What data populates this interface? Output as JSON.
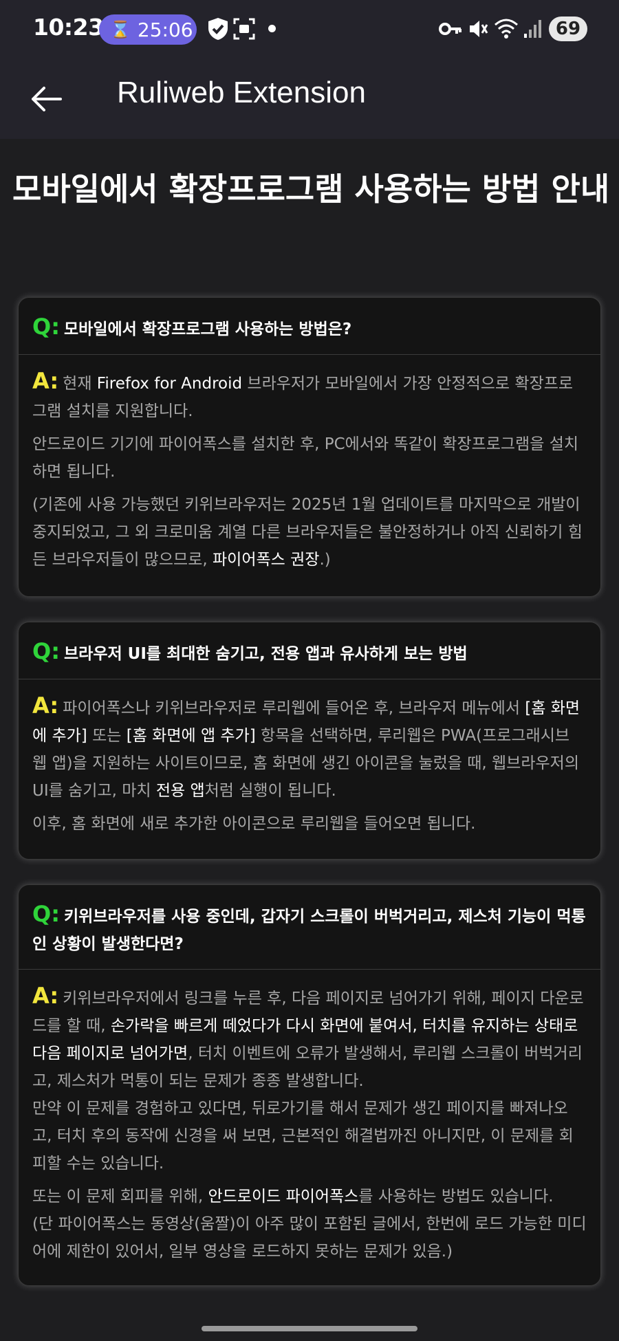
{
  "status_bar": {
    "time": "10:23",
    "timer": "25:06",
    "battery": "69"
  },
  "app_bar": {
    "title": "Ruliweb Extension"
  },
  "page": {
    "title": "모바일에서 확장프로그램 사용하는 방법 안내"
  },
  "faq": [
    {
      "q_mark": "Q:",
      "question": "모바일에서 확장프로그램 사용하는 방법은?",
      "a_mark": "A:",
      "p1_a": "현재 ",
      "p1_b": "Firefox for Android",
      "p1_c": " 브라우저가 모바일에서 가장 안정적으로 확장프로그램 설치를 지원합니다.",
      "p2": "안드로이드 기기에 파이어폭스를 설치한 후, PC에서와 똑같이 확장프로그램을 설치하면 됩니다.",
      "p3_a": "(기존에 사용 가능했던 키위브라우저는 2025년 1월 업데이트를 마지막으로 개발이 중지되었고, 그 외 크로미움 계열 다른 브라우저들은 불안정하거나 아직 신뢰하기 힘든 브라우저들이 많으므로, ",
      "p3_b": "파이어폭스 권장",
      "p3_c": ".)"
    },
    {
      "q_mark": "Q:",
      "question": "브라우저 UI를 최대한 숨기고, 전용 앱과 유사하게 보는 방법",
      "a_mark": "A:",
      "p1_a": "파이어폭스나 키위브라우저로 루리웹에 들어온 후, 브라우저 메뉴에서 ",
      "p1_b": "[홈 화면에 추가]",
      "p1_c": " 또는 ",
      "p1_d": "[홈 화면에 앱 추가]",
      "p1_e": " 항목을 선택하면, 루리웹은 PWA(프로그래시브 웹 앱)을 지원하는 사이트이므로, 홈 화면에 생긴 아이콘을 눌렀을 때, 웹브라우저의 UI를 숨기고, 마치 ",
      "p1_f": "전용 앱",
      "p1_g": "처럼 실행이 됩니다.",
      "p2": "이후, 홈 화면에 새로 추가한 아이콘으로 루리웹을 들어오면 됩니다."
    },
    {
      "q_mark": "Q:",
      "question": "키위브라우저를 사용 중인데, 갑자기 스크롤이 버벅거리고, 제스처 기능이 먹통인 상황이 발생한다면?",
      "a_mark": "A:",
      "p1_a": "키위브라우저에서 링크를 누른 후, 다음 페이지로 넘어가기 위해, 페이지 다운로드를 할 때, ",
      "p1_b": "손가락을 빠르게 떼었다가 다시 화면에 붙여서, 터치를 유지하는 상태로 다음 페이지로 넘어가면",
      "p1_c": ", 터치 이벤트에 오류가 발생해서, 루리웹 스크롤이 버벅거리고, 제스처가 먹통이 되는 문제가 종종 발생합니다.",
      "p2": "만약 이 문제를 경험하고 있다면, 뒤로가기를 해서 문제가 생긴 페이지를 빠져나오고, 터치 후의 동작에 신경을 써 보면, 근본적인 해결법까진 아니지만, 이 문제를 회피할 수는 있습니다.",
      "p3_a": "또는 이 문제 회피를 위해, ",
      "p3_b": "안드로이드 파이어폭스",
      "p3_c": "를 사용하는 방법도 있습니다.",
      "p4": "(단 파이어폭스는 동영상(움짤)이 아주 많이 포함된 글에서, 한번에 로드 가능한 미디어에 제한이 있어서, 일부 영상을 로드하지 못하는 문제가 있음.)"
    }
  ]
}
